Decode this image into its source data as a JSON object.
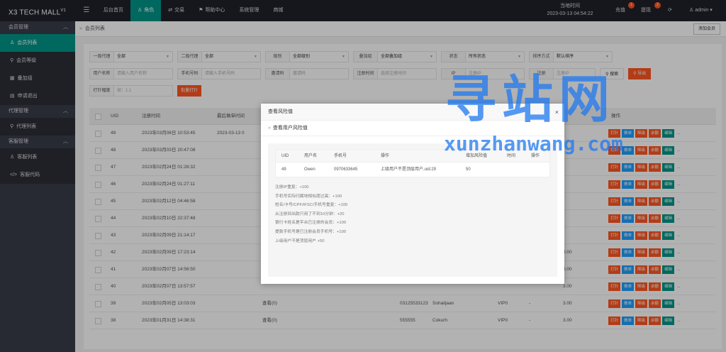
{
  "app": {
    "logo": "X3 TECH MALL",
    "logo_version": "V1"
  },
  "topnav": [
    {
      "label": "后台首页",
      "icon": ""
    },
    {
      "label": "角色",
      "icon": "user-icon",
      "active": true
    },
    {
      "label": "交易",
      "icon": "swap-icon"
    },
    {
      "label": "帮助中心",
      "icon": "flag-icon"
    },
    {
      "label": "系统管理",
      "icon": ""
    },
    {
      "label": "商城",
      "icon": ""
    }
  ],
  "header": {
    "clock_label": "当地时间",
    "clock_value": "2023-03-13 04:54:22",
    "recharge": "充值",
    "recharge_badge": "1",
    "withdraw": "提现",
    "withdraw_badge": "2",
    "admin": "admin"
  },
  "sidebar": {
    "groups": [
      {
        "label": "会员管理",
        "items": [
          {
            "label": "会员列表",
            "icon": "user-icon",
            "active": true
          },
          {
            "label": "会员等级",
            "icon": "link-icon"
          },
          {
            "label": "叠加组",
            "icon": "grid-icon"
          },
          {
            "label": "申请退出",
            "icon": "doc-icon"
          }
        ]
      },
      {
        "label": "代理管理",
        "items": [
          {
            "label": "代理列表",
            "icon": "link-icon"
          }
        ]
      },
      {
        "label": "客服管理",
        "items": [
          {
            "label": "客服列表",
            "icon": "users-icon"
          },
          {
            "label": "客服代码",
            "icon": "code-icon"
          }
        ]
      }
    ]
  },
  "breadcrumb": "会员列表",
  "add_member": "添加会员",
  "filters": {
    "row1": [
      {
        "label": "一级代理",
        "value": "全部"
      },
      {
        "label": "二级代理",
        "value": "全部"
      },
      {
        "label": "级别",
        "value": "全部级别"
      },
      {
        "label": "叠加组",
        "value": "全部叠加组"
      },
      {
        "label": "状态",
        "value": "所有状态"
      },
      {
        "label": "排序方式",
        "value": "默认排序"
      }
    ],
    "row2": [
      {
        "label": "用户名称",
        "placeholder": "请输入用户名称"
      },
      {
        "label": "手机号码",
        "placeholder": "请输入手机号码"
      },
      {
        "label": "邀请码",
        "placeholder": "邀请码"
      },
      {
        "label": "注册时间",
        "placeholder": "选择注册时间"
      },
      {
        "label": "IP",
        "placeholder": "注册IP"
      },
      {
        "label": "注册",
        "placeholder": "注册IP"
      }
    ],
    "search": "搜索",
    "export": "导出",
    "batch_label": "打针幅度",
    "batch_placeholder": "如：1.1",
    "batch_button": "批量打针"
  },
  "table": {
    "headers": [
      "UID",
      "注册时间",
      "最后做单时间",
      "操作"
    ],
    "rows": [
      {
        "uid": "49",
        "time": "2023年03月08日 10:53:45",
        "last": "2023-03-13 0",
        "view": "",
        "phone": "",
        "name": "",
        "vip": "",
        "dash": "",
        "balance": ""
      },
      {
        "uid": "48",
        "time": "2023年03月03日 20:47:08",
        "last": "",
        "view": "",
        "phone": "",
        "name": "",
        "vip": "",
        "dash": "",
        "balance": ""
      },
      {
        "uid": "47",
        "time": "2023年02月24日 01:28:32",
        "last": "",
        "view": "",
        "phone": "",
        "name": "",
        "vip": "",
        "dash": "",
        "balance": ""
      },
      {
        "uid": "46",
        "time": "2023年02月24日 01:27:11",
        "last": "",
        "view": "",
        "phone": "",
        "name": "",
        "vip": "",
        "dash": "",
        "balance": ""
      },
      {
        "uid": "45",
        "time": "2023年02月12日 04:46:58",
        "last": "",
        "view": "",
        "phone": "",
        "name": "",
        "vip": "",
        "dash": "",
        "balance": ""
      },
      {
        "uid": "44",
        "time": "2023年02月10日 22:37:48",
        "last": "",
        "view": "",
        "phone": "",
        "name": "",
        "vip": "",
        "dash": "",
        "balance": ""
      },
      {
        "uid": "43",
        "time": "2023年02月09日 21:14:17",
        "last": "",
        "view": "",
        "phone": "",
        "name": "",
        "vip": "",
        "dash": "",
        "balance": ""
      },
      {
        "uid": "42",
        "time": "2023年02月09日 17:23:14",
        "last": "",
        "view": "",
        "phone": "",
        "name": "",
        "vip": "",
        "dash": "",
        "balance": "3.00"
      },
      {
        "uid": "41",
        "time": "2023年02月07日 14:56:50",
        "last": "",
        "view": "",
        "phone": "",
        "name": "",
        "vip": "",
        "dash": "",
        "balance": "3.00"
      },
      {
        "uid": "40",
        "time": "2023年02月07日 13:57:57",
        "last": "",
        "view": "",
        "phone": "",
        "name": "",
        "vip": "",
        "dash": "",
        "balance": "3.00"
      },
      {
        "uid": "39",
        "time": "2023年02月05日 13:03:03",
        "last": "",
        "view": "查看(0)",
        "phone": "03125533123",
        "name": "Sohailjaan",
        "vip": "VIP0",
        "dash": "-",
        "balance": "3.00"
      },
      {
        "uid": "38",
        "time": "2023年01月31日 14:38:31",
        "last": "",
        "view": "查看(0)",
        "phone": "555555",
        "name": "Cokurh",
        "vip": "VIP0",
        "dash": "-",
        "balance": "3.00"
      }
    ],
    "ops": [
      "打针",
      "做单",
      "降级",
      "余额",
      "编辑",
      "..."
    ]
  },
  "modal": {
    "title": "查看风险值",
    "subtitle": "查看用户风险值",
    "close": "×",
    "headers": [
      "UID",
      "用户名",
      "手机号",
      "操作",
      "增加风险值",
      "时间",
      "操作"
    ],
    "row": [
      "49",
      "Owen",
      "0970633645",
      "上级用户不是顶层用户,uid:29",
      "50",
      "",
      ""
    ],
    "rules": [
      "注册IP重复：+100",
      "手机号实际归属地相似度过高：+100",
      "姓名/卡号/CPF/IFSC/手机号重复：+100",
      "从注册到出款只用了不到10分钟：+20",
      "银行卡姓名是平台已注册的会员：+100",
      "提款手机号是已注册会员手机号：+100",
      "上级用户不是顶层用户 +50"
    ]
  },
  "watermark": {
    "cn": "寻站网",
    "en": "xunzhanwang.com"
  }
}
